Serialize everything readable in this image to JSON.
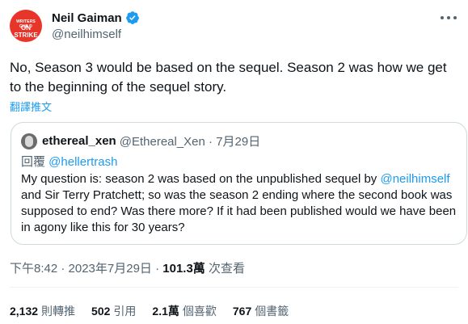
{
  "author": {
    "avatar_line1": "WRITERS GUILD",
    "avatar_line2": "ON STRIKE",
    "name": "Neil Gaiman",
    "handle": "@neilhimself"
  },
  "tweet": {
    "text": "No, Season 3 would be based on the sequel. Season 2 was how we get to the beginning of the sequel story.",
    "translate_label": "翻譯推文"
  },
  "quote": {
    "name": "ethereal_xen",
    "handle_time": "@Ethereal_Xen · 7月29日",
    "reply_prefix": "回覆 ",
    "reply_mention": "@hellertrash",
    "body_part1": "My question is: season 2 was based on the unpublished sequel by ",
    "body_mention": "@neilhimself",
    "body_part2": " and Sir Terry Pratchett; so was the season 2 ending where the second book was supposed to end? Was there more? If it had been published would we have been in agony like this for 30 years?"
  },
  "meta": {
    "time": "下午8:42 · 2023年7月29日 · ",
    "views_count": "101.3萬",
    "views_label": " 次查看"
  },
  "stats": [
    {
      "count": "2,132",
      "label": "則轉推"
    },
    {
      "count": "502",
      "label": "引用"
    },
    {
      "count": "2.1萬",
      "label": "個喜歡"
    },
    {
      "count": "767",
      "label": "個書籤"
    }
  ],
  "colors": {
    "accent": "#1d9bf0",
    "avatar_bg": "#e8352a",
    "muted": "#536471"
  }
}
